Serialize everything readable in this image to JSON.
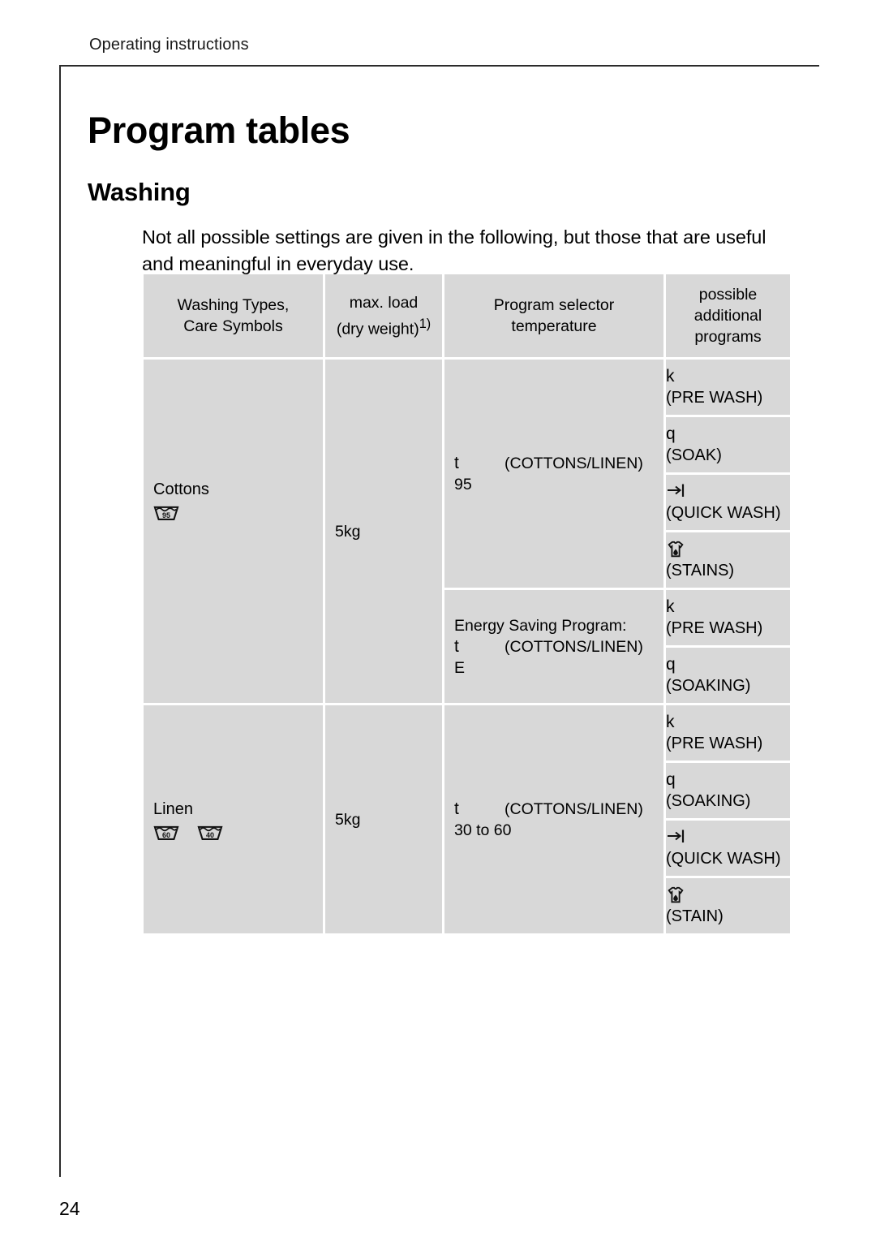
{
  "running_head": "Operating instructions",
  "page_title": "Program tables",
  "section_title": "Washing",
  "intro": "Not all possible settings are given in the following, but those that are useful and meaningful in everyday use.",
  "page_number": "24",
  "table": {
    "headers": {
      "col1_line1": "Washing Types,",
      "col1_line2": "Care Symbols",
      "col2_line1": "max. load",
      "col2_line2": "(dry weight)",
      "col2_footnote": "1)",
      "col3_line1": "Program selector",
      "col3_line2": "temperature",
      "col4_line1": "possible",
      "col4_line2": "additional",
      "col4_line3": "programs"
    },
    "rows": [
      {
        "type_name": "Cottons",
        "care_symbols": [
          "95"
        ],
        "max_load": "5kg",
        "programs": [
          {
            "prefix": "",
            "selector_letter": "t",
            "selector_label": "(COTTONS/LINEN)",
            "temperature": "95",
            "suffix": "",
            "additional": [
              {
                "symbol": "k",
                "icon": "none",
                "label": "(PRE WASH)"
              },
              {
                "symbol": "q",
                "icon": "none",
                "label": "(SOAK)"
              },
              {
                "symbol": "",
                "icon": "quick-wash-arrow",
                "label": "(QUICK WASH)"
              },
              {
                "symbol": "",
                "icon": "stained-shirt",
                "label": "(STAINS)"
              }
            ]
          },
          {
            "prefix": "Energy Saving Program:",
            "selector_letter": "t",
            "selector_label": "(COTTONS/LINEN)",
            "temperature": "",
            "suffix": "E",
            "additional": [
              {
                "symbol": "k",
                "icon": "none",
                "label": "(PRE WASH)"
              },
              {
                "symbol": "q",
                "icon": "none",
                "label": "(SOAKING)"
              }
            ]
          }
        ]
      },
      {
        "type_name": "Linen",
        "care_symbols": [
          "60",
          "40"
        ],
        "max_load": "5kg",
        "programs": [
          {
            "prefix": "",
            "selector_letter": "t",
            "selector_label": "(COTTONS/LINEN)",
            "temperature": "30 to  60",
            "suffix": "",
            "additional": [
              {
                "symbol": "k",
                "icon": "none",
                "label": "(PRE WASH)"
              },
              {
                "symbol": "q",
                "icon": "none",
                "label": "(SOAKING)"
              },
              {
                "symbol": "",
                "icon": "quick-wash-arrow",
                "label": "(QUICK WASH)"
              },
              {
                "symbol": "",
                "icon": "stained-shirt",
                "label": "(STAIN)"
              }
            ]
          }
        ]
      }
    ]
  },
  "colors": {
    "cell_background": "#d8d8d8",
    "rule": "#2b2b2b",
    "text": "#000000"
  }
}
